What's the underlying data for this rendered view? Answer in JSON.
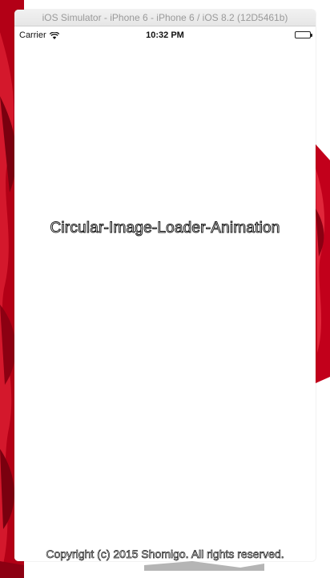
{
  "simulator": {
    "title": "iOS Simulator - iPhone 6 - iPhone 6 / iOS 8.2 (12D5461b)"
  },
  "status_bar": {
    "carrier": "Carrier",
    "time": "10:32 PM",
    "wifi_icon": "wifi-icon",
    "battery_icon": "battery-icon"
  },
  "app": {
    "title": "Circular-Image-Loader-Animation",
    "copyright": "Copyright (c) 2015 Shomigo. All rights reserved."
  },
  "colors": {
    "backdrop_red": "#c0001a",
    "titlebar": "#e9e9e9",
    "background": "#ffffff"
  }
}
